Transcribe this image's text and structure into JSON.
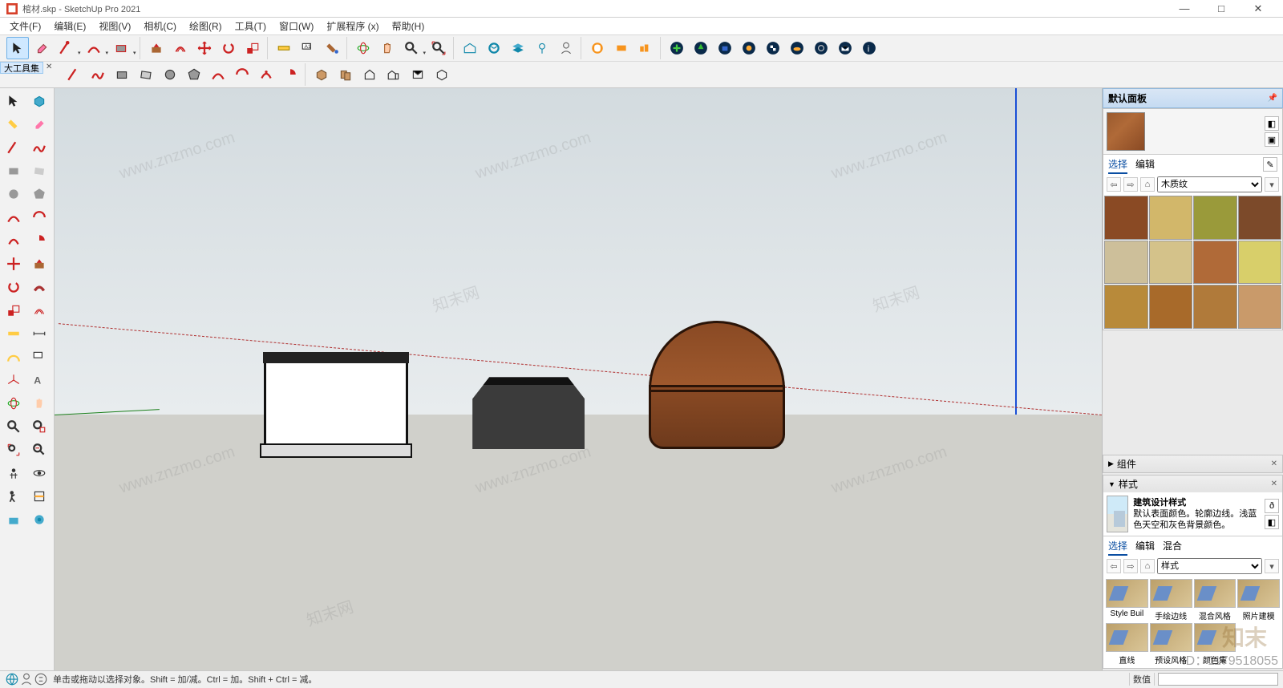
{
  "window": {
    "title": "棺材.skp - SketchUp Pro 2021",
    "minimize": "—",
    "maximize": "□",
    "close": "✕"
  },
  "menu": {
    "items": [
      {
        "label": "文件(F)"
      },
      {
        "label": "编辑(E)"
      },
      {
        "label": "视图(V)"
      },
      {
        "label": "相机(C)"
      },
      {
        "label": "绘图(R)"
      },
      {
        "label": "工具(T)"
      },
      {
        "label": "窗口(W)"
      },
      {
        "label": "扩展程序 (x)"
      },
      {
        "label": "帮助(H)"
      }
    ]
  },
  "toolbox_label": "大工具集",
  "watermarks": [
    "www.znzmo.com",
    "知末网",
    "知末"
  ],
  "id_overlay": "ID：1179518055",
  "panels": {
    "tray_title": "默认面板",
    "materials": {
      "tab_select": "选择",
      "tab_edit": "编辑",
      "dropdown": "木质纹",
      "swatches": [
        "#8a4a24",
        "#d2b76a",
        "#9a9a3a",
        "#7c4a2a",
        "#cdbf9a",
        "#d4c28a",
        "#b06a38",
        "#d8cf6a",
        "#b88a3a",
        "#a86a2a",
        "#b07a3a",
        "#c99a6a"
      ]
    },
    "components": {
      "title": "组件"
    },
    "styles": {
      "title": "样式",
      "style_name": "建筑设计样式",
      "style_desc": "默认表面颜色。轮廓边线。浅蓝色天空和灰色背景颜色。",
      "tab_select": "选择",
      "tab_edit": "编辑",
      "tab_mix": "混合",
      "dropdown": "样式",
      "thumbs": [
        {
          "label": "Style Buil"
        },
        {
          "label": "手绘边线"
        },
        {
          "label": "混合风格"
        },
        {
          "label": "照片建模"
        },
        {
          "label": "直线"
        },
        {
          "label": "预设风格"
        },
        {
          "label": "颜色集"
        },
        {
          "label": ""
        }
      ]
    }
  },
  "status": {
    "hint": "单击或拖动以选择对象。Shift = 加/减。Ctrl = 加。Shift + Ctrl = 减。",
    "measure_label": "数值"
  }
}
